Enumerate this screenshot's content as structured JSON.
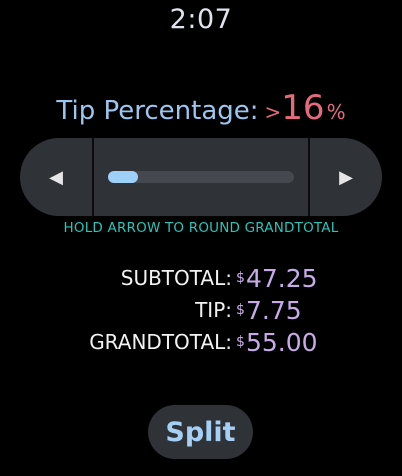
{
  "status": {
    "time": "2:07"
  },
  "tip": {
    "label": "Tip Percentage:",
    "more_indicator": ">",
    "value": "16",
    "unit": "%",
    "slider_fraction": 0.16
  },
  "slider": {
    "decrease_icon": "triangle-left",
    "increase_icon": "triangle-right"
  },
  "hint": "HOLD ARROW TO ROUND GRANDTOTAL",
  "totals": {
    "currency": "$",
    "subtotal_label": "SUBTOTAL:",
    "subtotal_value": "47.25",
    "tip_label": "TIP:",
    "tip_value": "7.75",
    "grandtotal_label": "GRANDTOTAL:",
    "grandtotal_value": "55.00"
  },
  "split_label": "Split",
  "colors": {
    "background": "#000000",
    "tip_accent": "#e66a7c",
    "label_blue": "#9cc6ef",
    "hint_teal": "#27c6b9",
    "amount_purple": "#c7abe8",
    "control_bg": "#2f3237"
  }
}
